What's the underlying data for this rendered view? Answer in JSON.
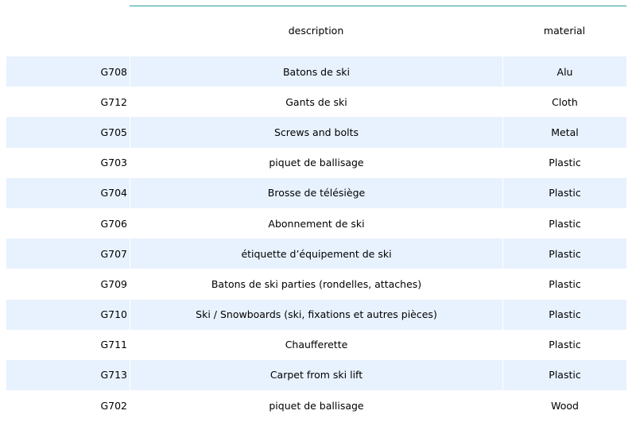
{
  "chart_data": {
    "type": "table",
    "columns": [
      "",
      "description",
      "material"
    ],
    "rows": [
      {
        "code": "G708",
        "description": "Batons de ski",
        "material": "Alu"
      },
      {
        "code": "G712",
        "description": "Gants de ski",
        "material": "Cloth"
      },
      {
        "code": "G705",
        "description": "Screws and bolts",
        "material": "Metal"
      },
      {
        "code": "G703",
        "description": "piquet de ballisage",
        "material": "Plastic"
      },
      {
        "code": "G704",
        "description": "Brosse de télésiège",
        "material": "Plastic"
      },
      {
        "code": "G706",
        "description": "Abonnement de ski",
        "material": "Plastic"
      },
      {
        "code": "G707",
        "description": "étiquette d’équipement de ski",
        "material": "Plastic"
      },
      {
        "code": "G709",
        "description": "Batons de ski parties (rondelles, attaches)",
        "material": "Plastic"
      },
      {
        "code": "G710",
        "description": "Ski / Snowboards (ski, fixations et autres pièces)",
        "material": "Plastic"
      },
      {
        "code": "G711",
        "description": "Chaufferette",
        "material": "Plastic"
      },
      {
        "code": "G713",
        "description": "Carpet from ski lift",
        "material": "Plastic"
      },
      {
        "code": "G702",
        "description": "piquet de ballisage",
        "material": "Wood"
      }
    ]
  },
  "colors": {
    "stripe": "#e8f2fe",
    "header_rule": "#2a9d9d",
    "text": "#000000"
  }
}
